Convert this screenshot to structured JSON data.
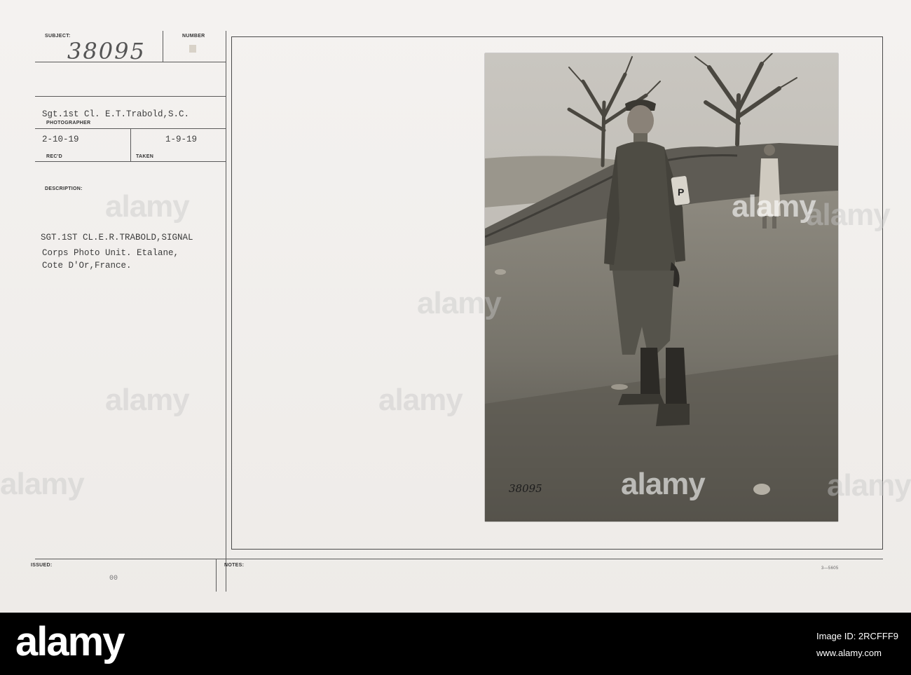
{
  "record": {
    "subject_label": "SUBJECT:",
    "subject_number": "38095",
    "number_label": "NUMBER",
    "photographer_value": "Sgt.1st Cl. E.T.Trabold,S.C.",
    "photographer_label": "PHOTOGRAPHER",
    "recd_value": "2-10-19",
    "recd_label": "REC'D",
    "taken_value": "1-9-19",
    "taken_label": "TAKEN",
    "description_label": "DESCRIPTION:",
    "description_lines": [
      "SGT.1ST CL.E.R.TRABOLD,SIGNAL",
      "Corps Photo Unit. Etalane,",
      "Cote D'Or,France."
    ],
    "issued_label": "ISSUED:",
    "issued_mark": "00",
    "notes_label": "NOTES:",
    "form_code": "3—5605"
  },
  "photo": {
    "inscription": "38095",
    "armband_letter": "P"
  },
  "watermark": {
    "text": "alamy"
  },
  "banner": {
    "logo": "alamy",
    "image_id_label": "Image ID: 2RCFFF9",
    "url": "www.alamy.com"
  }
}
